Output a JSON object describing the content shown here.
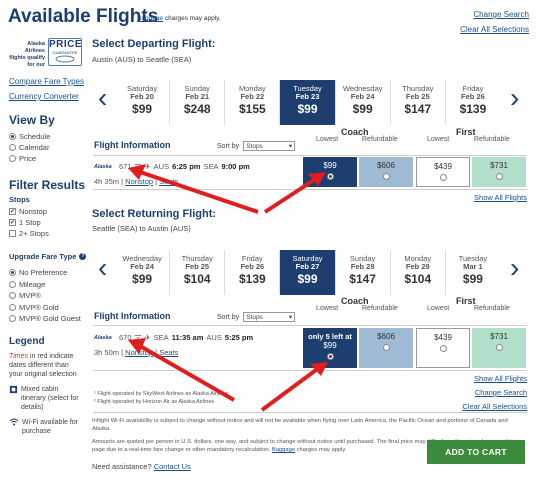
{
  "header": {
    "title": "Available Flights",
    "baggage_link": "Baggage",
    "baggage_text": " charges may apply.",
    "change_search": "Change Search",
    "clear_all": "Clear All Selections"
  },
  "sidebar": {
    "badge_text_1": "Alaska Airlines",
    "badge_text_2": "flights qualify",
    "badge_text_3": "for our",
    "badge_price": "PRICE",
    "badge_guarantee": "GUARANTEE",
    "compare_link": "Compare Fare Types",
    "currency_link": "Currency Converter",
    "viewby_title": "View By",
    "viewby_options": [
      "Schedule",
      "Calendar",
      "Price"
    ],
    "filter_title": "Filter Results",
    "stops_title": "Stops",
    "stops_options": [
      "Nonstop",
      "1 Stop",
      "2+ Stops"
    ],
    "upgrade_title": "Upgrade Fare Type",
    "upgrade_help": "?",
    "upgrade_options": [
      "No Preference",
      "Mileage",
      "MVP®",
      "MVP® Gold",
      "MVP® Gold Guest"
    ],
    "legend_title": "Legend",
    "legend_red_em": "Times",
    "legend_red_text": " in red indicate dates different than your original selection",
    "legend_mixed": "Mixed cabin itinerary (select for details)",
    "legend_wifi": "Wi-Fi available for purchase"
  },
  "departing": {
    "title": "Select Departing Flight:",
    "route": "Austin (AUS) to Seattle (SEA)",
    "dates": [
      {
        "day": "Saturday",
        "date": "Feb 20",
        "price": "$99"
      },
      {
        "day": "Sunday",
        "date": "Feb 21",
        "price": "$248"
      },
      {
        "day": "Monday",
        "date": "Feb 22",
        "price": "$155"
      },
      {
        "day": "Tuesday",
        "date": "Feb 23",
        "price": "$99",
        "selected": true
      },
      {
        "day": "Wednesday",
        "date": "Feb 24",
        "price": "$99"
      },
      {
        "day": "Thursday",
        "date": "Feb 25",
        "price": "$147"
      },
      {
        "day": "Friday",
        "date": "Feb 26",
        "price": "$139"
      }
    ],
    "flight": {
      "number": "671",
      "depart_airport": "AUS",
      "depart_time": "6:25 pm",
      "arrive_airport": "SEA",
      "arrive_time": "9:00 pm",
      "duration": "4h 35m",
      "stops": "Nonstop",
      "seats": "Seats",
      "fares": {
        "coach_low": "$99",
        "coach_ref": "$606",
        "first_low": "$439",
        "first_ref": "$731"
      }
    },
    "show_all": "Show All Flights"
  },
  "returning": {
    "title": "Select Returning Flight:",
    "route": "Seattle (SEA) to Austin (AUS)",
    "dates": [
      {
        "day": "Wednesday",
        "date": "Feb 24",
        "price": "$99"
      },
      {
        "day": "Thursday",
        "date": "Feb 25",
        "price": "$104"
      },
      {
        "day": "Friday",
        "date": "Feb 26",
        "price": "$139"
      },
      {
        "day": "Saturday",
        "date": "Feb 27",
        "price": "$99",
        "selected": true
      },
      {
        "day": "Sunday",
        "date": "Feb 28",
        "price": "$147"
      },
      {
        "day": "Monday",
        "date": "Feb 29",
        "price": "$104"
      },
      {
        "day": "Tuesday",
        "date": "Mar 1",
        "price": "$99"
      }
    ],
    "flight": {
      "number": "670",
      "depart_airport": "SEA",
      "depart_time": "11:35 am",
      "arrive_airport": "AUS",
      "arrive_time": "5:25 pm",
      "duration": "3h 50m",
      "stops": "Nonstop",
      "seats": "Seats",
      "seats_left": "only 5 left at",
      "fares": {
        "coach_low": "$99",
        "coach_ref": "$606",
        "first_low": "$439",
        "first_ref": "$731"
      }
    },
    "show_all": "Show All Flights",
    "change_search": "Change Search",
    "clear_all": "Clear All Selections"
  },
  "table": {
    "flight_info": "Flight Information",
    "sort_by": "Sort by",
    "sort_value": "Stops",
    "coach": "Coach",
    "first": "First",
    "lowest": "Lowest",
    "refundable": "Refundable"
  },
  "footnotes": {
    "note1": "¹ Flight operated by SkyWest Airlines as Alaska Airlines",
    "note2": "² Flight operated by Horizon Air as Alaska Airlines",
    "wifi_note": "Inflight Wi-Fi availability is subject to change without notice and will not be available when flying over Latin America, the Pacific Ocean and portions of Canada and Alaska.",
    "amounts_note": "Amounts are quoted per person in U.S. dollars, one way, and subject to change without notice until purchased. The final price may differ from the price shown on this page due to a real-time fare change or other mandatory recalculation.",
    "amounts_baggage": "Baggage",
    "amounts_tail": " charges may apply.",
    "need_help": "Need assistance?",
    "contact": "Contact Us"
  },
  "cart": {
    "label": "ADD TO CART"
  },
  "colors": {
    "navy": "#1d3e6e",
    "coach_ref": "#9fbad3",
    "first_ref": "#b2dfc9",
    "cart_green": "#3c8a3c",
    "arrow_red": "#e01e1e"
  }
}
